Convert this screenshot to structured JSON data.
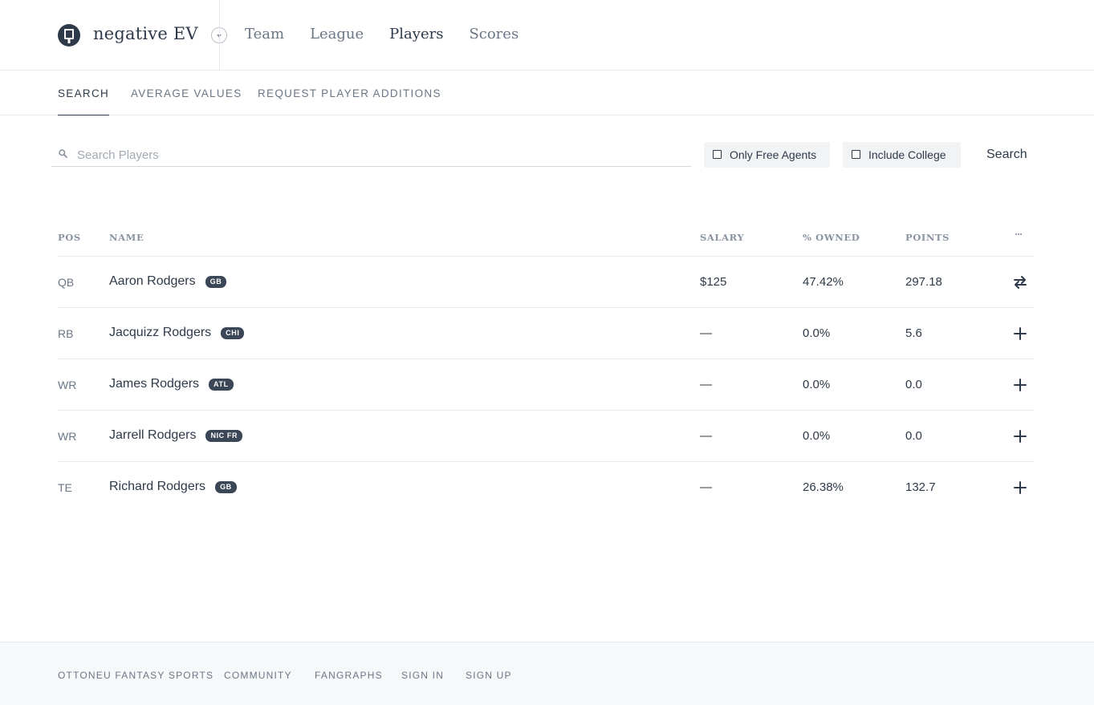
{
  "header": {
    "team_name": "negative EV",
    "nav": [
      "Team",
      "League",
      "Players",
      "Scores"
    ],
    "active_nav": "Players"
  },
  "sub_nav": {
    "tabs": [
      "SEARCH",
      "AVERAGE VALUES",
      "REQUEST PLAYER ADDITIONS"
    ],
    "active_tab": "SEARCH"
  },
  "search": {
    "placeholder": "Search Players",
    "value": "",
    "only_free_agents_label": "Only Free Agents",
    "only_free_agents_checked": false,
    "include_college_label": "Include College",
    "include_college_checked": false,
    "button_label": "Search"
  },
  "table": {
    "headers": {
      "pos": "POS",
      "name": "NAME",
      "salary": "SALARY",
      "owned": "% OWNED",
      "points": "POINTS",
      "more": "···"
    },
    "rows": [
      {
        "pos": "QB",
        "name": "Aaron Rodgers",
        "team": "GB",
        "salary": "$125",
        "owned": "47.42%",
        "points": "297.18",
        "action": "swap-icon"
      },
      {
        "pos": "RB",
        "name": "Jacquizz Rodgers",
        "team": "CHI",
        "salary": "—",
        "owned": "0.0%",
        "points": "5.6",
        "action": "plus-icon"
      },
      {
        "pos": "WR",
        "name": "James Rodgers",
        "team": "ATL",
        "salary": "—",
        "owned": "0.0%",
        "points": "0.0",
        "action": "plus-icon"
      },
      {
        "pos": "WR",
        "name": "Jarrell Rodgers",
        "team": "NIC FR",
        "salary": "—",
        "owned": "0.0%",
        "points": "0.0",
        "action": "plus-icon"
      },
      {
        "pos": "TE",
        "name": "Richard Rodgers",
        "team": "GB",
        "salary": "—",
        "owned": "26.38%",
        "points": "132.7",
        "action": "plus-icon"
      }
    ]
  },
  "footer": {
    "links": [
      "OTTONEU FANTASY SPORTS",
      "COMMUNITY",
      "FANGRAPHS",
      "SIGN IN",
      "SIGN UP"
    ]
  },
  "colors": {
    "text": "#2e3a4a",
    "muted": "#6b7685",
    "badge": "#3b4657",
    "footer_bg": "#f6f8fa"
  }
}
